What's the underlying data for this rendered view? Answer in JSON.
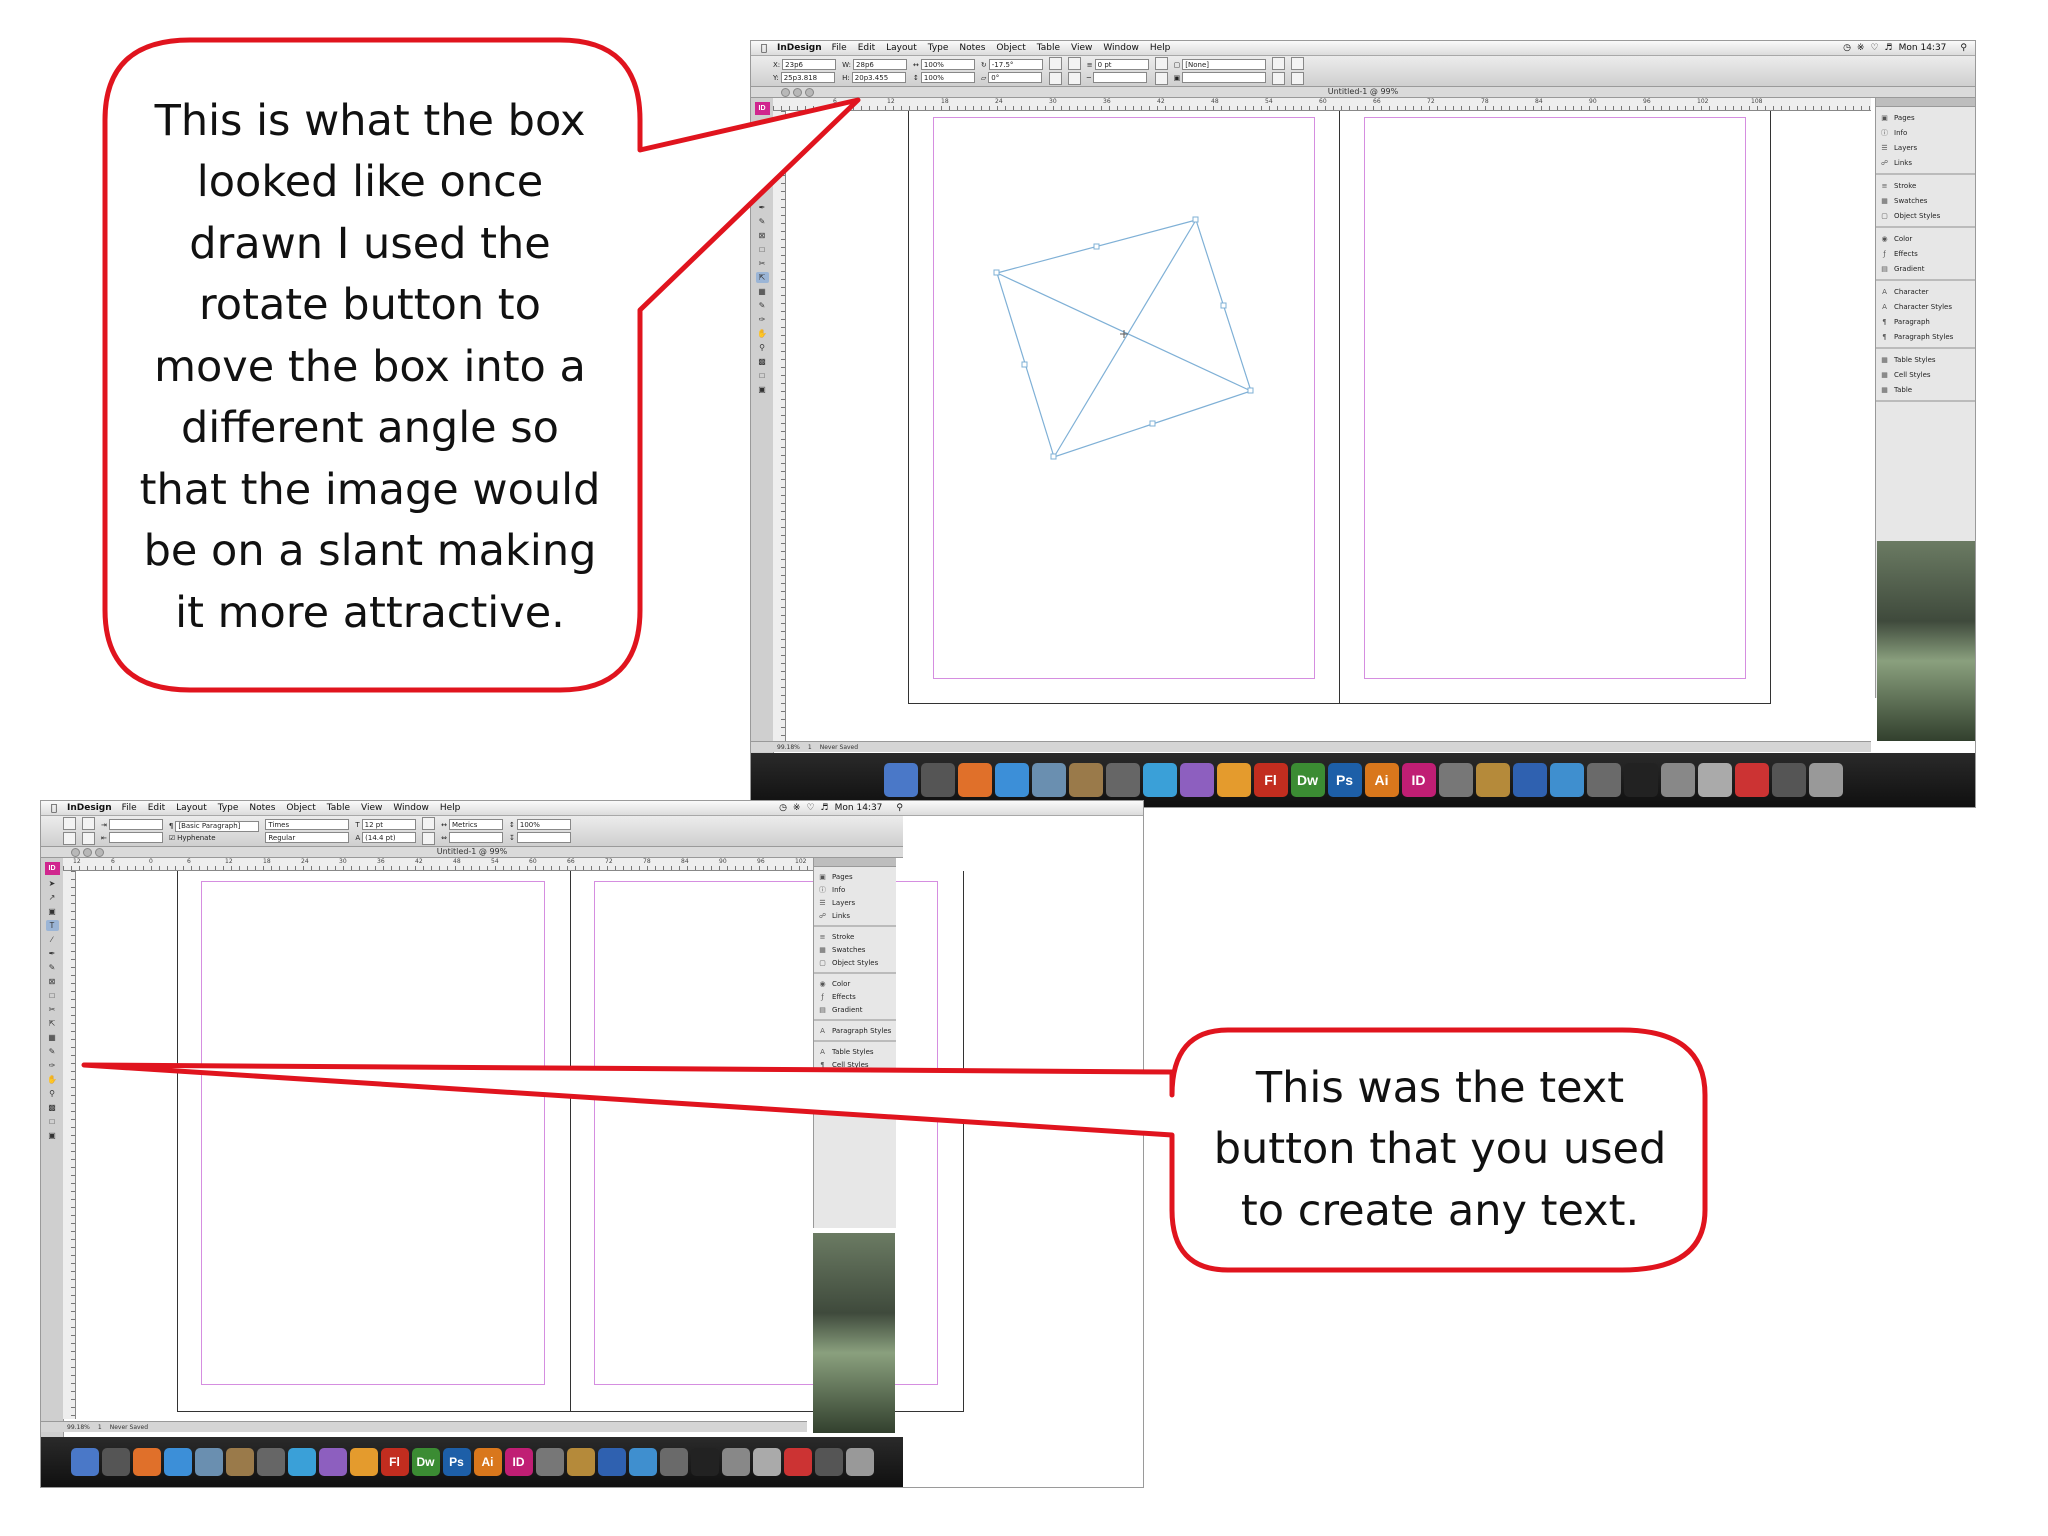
{
  "colors": {
    "callout_border": "#e0141e",
    "margin_guide": "#d58ee0",
    "frame_stroke": "#7fb0d6",
    "indesign_brand": "#d0268e"
  },
  "callouts": {
    "top": {
      "lines": [
        "This is what the box",
        "looked like once",
        "drawn I used the",
        "rotate button to",
        "move the box into a",
        "different angle so",
        "that the image would",
        "be on a slant making",
        "it more attractive."
      ]
    },
    "bottom": {
      "lines": [
        "This was the text",
        "button that you used",
        "to create any text."
      ]
    }
  },
  "screenshot_top": {
    "menu": {
      "app": "InDesign",
      "items": [
        "File",
        "Edit",
        "Layout",
        "Type",
        "Notes",
        "Object",
        "Table",
        "View",
        "Window",
        "Help"
      ],
      "clock": "Mon 14:37"
    },
    "control": {
      "x": "23p6",
      "y": "25p3.818",
      "w": "28p6",
      "h": "20p3.455",
      "scale_x": "100%",
      "scale_y": "100%",
      "rotate": "-17.5°",
      "shear": "0°",
      "stroke": "0 pt",
      "fill": "[None]"
    },
    "doc_title": "Untitled-1 @ 99%",
    "ruler_ticks": [
      "6",
      "12",
      "18",
      "24",
      "30",
      "36",
      "42",
      "48",
      "54",
      "60",
      "66",
      "72",
      "78",
      "84",
      "90",
      "96",
      "102",
      "108"
    ],
    "status": {
      "zoom": "99.18%",
      "page": "1",
      "state": "Never Saved"
    }
  },
  "screenshot_bottom": {
    "menu": {
      "app": "InDesign",
      "items": [
        "File",
        "Edit",
        "Layout",
        "Type",
        "Notes",
        "Object",
        "Table",
        "View",
        "Window",
        "Help"
      ],
      "clock": "Mon 14:37"
    },
    "control": {
      "paragraph_style": "[Basic Paragraph]",
      "hyphenate": "Hyphenate",
      "font": "Times",
      "font_style": "Regular",
      "size": "12 pt",
      "leading": "(14.4 pt)",
      "kerning": "Metrics",
      "scale": "100%"
    },
    "doc_title": "Untitled-1 @ 99%",
    "ruler_ticks": [
      "12",
      "6",
      "0",
      "6",
      "12",
      "18",
      "24",
      "30",
      "36",
      "42",
      "48",
      "54",
      "60",
      "66",
      "72",
      "78",
      "84",
      "90",
      "96",
      "102",
      "108"
    ],
    "status": {
      "zoom": "99.18%",
      "page": "1",
      "state": "Never Saved"
    }
  },
  "panels": {
    "groups": [
      [
        "Pages",
        "Info",
        "Layers",
        "Links"
      ],
      [
        "Stroke",
        "Swatches",
        "Object Styles"
      ],
      [
        "Color",
        "Effects",
        "Gradient"
      ],
      [
        "Character",
        "Character Styles",
        "Paragraph",
        "Paragraph Styles"
      ],
      [
        "Table Styles",
        "Cell Styles",
        "Table"
      ]
    ],
    "groups_bottom": [
      [
        "Pages",
        "Info",
        "Layers",
        "Links"
      ],
      [
        "Stroke",
        "Swatches",
        "Object Styles"
      ],
      [
        "Color",
        "Effects",
        "Gradient"
      ],
      [
        "Paragraph Styles"
      ],
      [
        "Table Styles",
        "Cell Styles",
        "Table"
      ]
    ]
  },
  "dock_apps": [
    "Finder",
    "Dashboard",
    "Firefox",
    "Safari",
    "iPhoto",
    "Preview",
    "Photo Booth",
    "iTunes",
    "Web",
    "Photoshop Elements",
    "Fl",
    "Dw",
    "Ps",
    "Ai",
    "ID",
    "Camera",
    "GarageBand",
    "Word",
    "iDVD",
    "TextEdit",
    "Clapper",
    "Automator",
    "Keychain",
    "Calendar",
    "iMovie",
    "Trash"
  ],
  "dock_labels": {
    "fl": "Fl",
    "dw": "Dw",
    "ps": "Ps",
    "ai": "Ai",
    "id": "ID"
  }
}
